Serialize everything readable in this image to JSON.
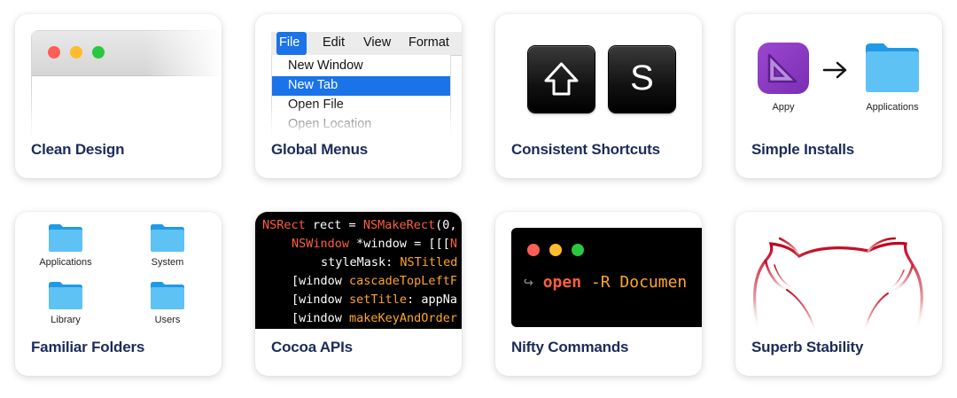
{
  "cards": {
    "clean_design": {
      "title": "Clean Design"
    },
    "global_menus": {
      "title": "Global Menus",
      "menubar": [
        "File",
        "Edit",
        "View",
        "Format"
      ],
      "menu_items": [
        "New Window",
        "New Tab",
        "Open File",
        "Open Location"
      ],
      "highlighted_item": "New Tab"
    },
    "consistent_shortcuts": {
      "title": "Consistent Shortcuts",
      "key_letter": "S"
    },
    "simple_installs": {
      "title": "Simple Installs",
      "app_label": "Appy",
      "folder_label": "Applications"
    },
    "familiar_folders": {
      "title": "Familiar Folders",
      "folders": [
        "Applications",
        "System",
        "Library",
        "Users"
      ]
    },
    "cocoa_apis": {
      "title": "Cocoa APIs",
      "code": {
        "l1_kw": "NSRect",
        "l1_mid": " rect = ",
        "l1_fn": "NSMakeRect",
        "l1_end": "(0,",
        "l2_kw": "NSWindow",
        "l2_mid": " *window = [[[",
        "l2_end": "N",
        "l3_mid": "styleMask: ",
        "l3_kw": "NSTitled",
        "l4_mid": "[window ",
        "l4_fn": "cascadeTopLeftF",
        "l5_mid": "[window ",
        "l5_fn": "setTitle",
        "l5_end": ": appNa",
        "l6_mid": "[window ",
        "l6_fn": "makeKeyAndOrder"
      }
    },
    "nifty_commands": {
      "title": "Nifty Commands",
      "prompt_arrow": "↪",
      "command": "open",
      "args": " -R Documen"
    },
    "superb_stability": {
      "title": "Superb Stability"
    }
  },
  "colors": {
    "title": "#1c2b5a",
    "traffic_red": "#ff5f57",
    "traffic_yellow": "#febc2e",
    "traffic_green": "#28c840",
    "menu_highlight": "#1a73e8",
    "code_keyword": "#ff5f3a",
    "code_function": "#ffa625",
    "daemon_red": "#b3001b"
  },
  "icons": [
    "shift-key-icon",
    "appy-app-icon",
    "arrow-right-icon",
    "folder-icon",
    "bsd-daemon-icon"
  ]
}
